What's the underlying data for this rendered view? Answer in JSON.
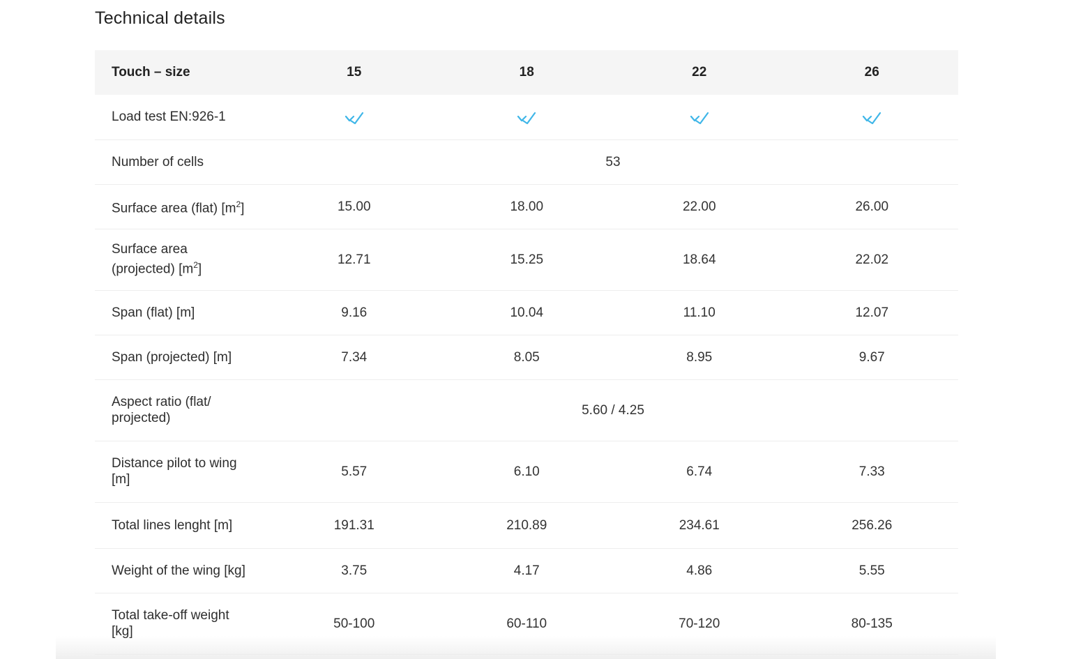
{
  "heading": "Technical details",
  "table": {
    "header_label": "Touch – size",
    "sizes": [
      "15",
      "18",
      "22",
      "26"
    ],
    "rows": {
      "load_test": {
        "label": "Load test EN:926-1",
        "icon": "check-icon",
        "icon_color": "#3fb6e8"
      },
      "number_of_cells": {
        "label": "Number of cells",
        "value": "53"
      },
      "surface_area_flat": {
        "label_main": "Surface area (flat) [m",
        "label_sup": "2",
        "label_end": "]",
        "values": [
          "15.00",
          "18.00",
          "22.00",
          "26.00"
        ]
      },
      "surface_area_projected": {
        "label_line1": "Surface area",
        "label_main": "(projected) [m",
        "label_sup": "2",
        "label_end": "]",
        "values": [
          "12.71",
          "15.25",
          "18.64",
          "22.02"
        ]
      },
      "span_flat": {
        "label": "Span (flat) [m]",
        "values": [
          "9.16",
          "10.04",
          "11.10",
          "12.07"
        ]
      },
      "span_projected": {
        "label": "Span (projected) [m]",
        "values": [
          "7.34",
          "8.05",
          "8.95",
          "9.67"
        ]
      },
      "aspect_ratio": {
        "label": "Aspect ratio (flat/ projected)",
        "value": "5.60 / 4.25"
      },
      "distance_pilot_to_wing": {
        "label": "Distance pilot to wing [m]",
        "values": [
          "5.57",
          "6.10",
          "6.74",
          "7.33"
        ]
      },
      "total_lines_length": {
        "label": "Total lines lenght [m]",
        "values": [
          "191.31",
          "210.89",
          "234.61",
          "256.26"
        ]
      },
      "weight_of_wing": {
        "label": "Weight of the wing [kg]",
        "values": [
          "3.75",
          "4.17",
          "4.86",
          "5.55"
        ]
      },
      "total_takeoff_weight": {
        "label": "Total take-off weight [kg]",
        "values": [
          "50-100",
          "60-110",
          "70-120",
          "80-135"
        ]
      }
    }
  }
}
